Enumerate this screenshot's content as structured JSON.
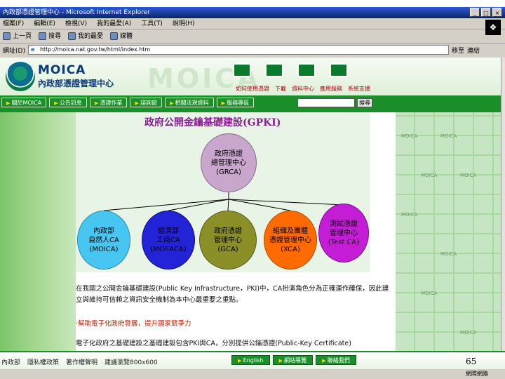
{
  "window": {
    "title": "內政部憑證管理中心 - Microsoft Internet Explorer",
    "controls": [
      "_",
      "□",
      "×"
    ]
  },
  "menu": [
    "檔案(F)",
    "編輯(E)",
    "檢視(V)",
    "我的最愛(A)",
    "工具(T)",
    "說明(H)"
  ],
  "toolbar": {
    "back": "上一頁",
    "search": "搜尋",
    "favorites": "我的最愛",
    "history": "媒體"
  },
  "address": {
    "label": "網址(D)",
    "url": "http://moica.nat.gov.tw/html/index.htm",
    "go": "移至",
    "links": "連結"
  },
  "site": {
    "logo_en": "MOICA",
    "logo_zh": "內政部憑證管理中心",
    "watermark": "MOICA",
    "top_links": [
      "如何使用憑證",
      "下載",
      "資料中心",
      "應用服務",
      "系統支援"
    ]
  },
  "nav": [
    "關於MOICA",
    "公告訊息",
    "憑證作業",
    "諮詢窗",
    "相關法規資料",
    "服務專區"
  ],
  "search": {
    "button": "搜尋"
  },
  "diagram": {
    "title": "政府公開金鑰基礎建設(GPKI)",
    "root": {
      "line1": "政府憑證",
      "line2": "總管理中心",
      "line3": "(GRCA)"
    },
    "children": [
      {
        "key": "moica",
        "line1": "內政部",
        "line2": "自然人CA",
        "line3": "(MOICA)"
      },
      {
        "key": "moeaca",
        "line1": "經濟部",
        "line2": "工商CA",
        "line3": "(MOEACA)"
      },
      {
        "key": "gca",
        "line1": "政府憑證",
        "line2": "管理中心",
        "line3": "(GCA)"
      },
      {
        "key": "xca",
        "line1": "組織及團體",
        "line2": "憑證管理中心",
        "line3": "(XCA)"
      },
      {
        "key": "testca",
        "line1": "測試憑證",
        "line2": "管理中心",
        "line3": "(Test CA)"
      }
    ]
  },
  "content": {
    "para1": "在我國之公開金鑰基礎建設(Public Key Infrastructure，PKI)中，CA扮演角色分為正確運作確保，因此建立與維持可信賴之資訊安全機制為本中心最重要之重點。",
    "link1": "‧幫助電子化政府發展，提升國家競爭力",
    "para2": "電子化政府之基礎建設之基礎建設包含PKI與CA，分別提供公鑰憑證(Public-Key Certificate)"
  },
  "right_tiles": [
    "MOICA",
    "MOICA",
    "MOICA",
    "MOICA",
    "MOICA",
    "MOICA",
    "MOICA",
    "MOICA"
  ],
  "footer": {
    "links": [
      "內政部",
      "隱私權政策",
      "著作權聲明",
      "建議瀏覽800x600"
    ],
    "buttons": [
      "English",
      "網站導覽",
      "聯絡我們"
    ],
    "slide_number": "65"
  },
  "status": {
    "zone": "網際網路"
  }
}
